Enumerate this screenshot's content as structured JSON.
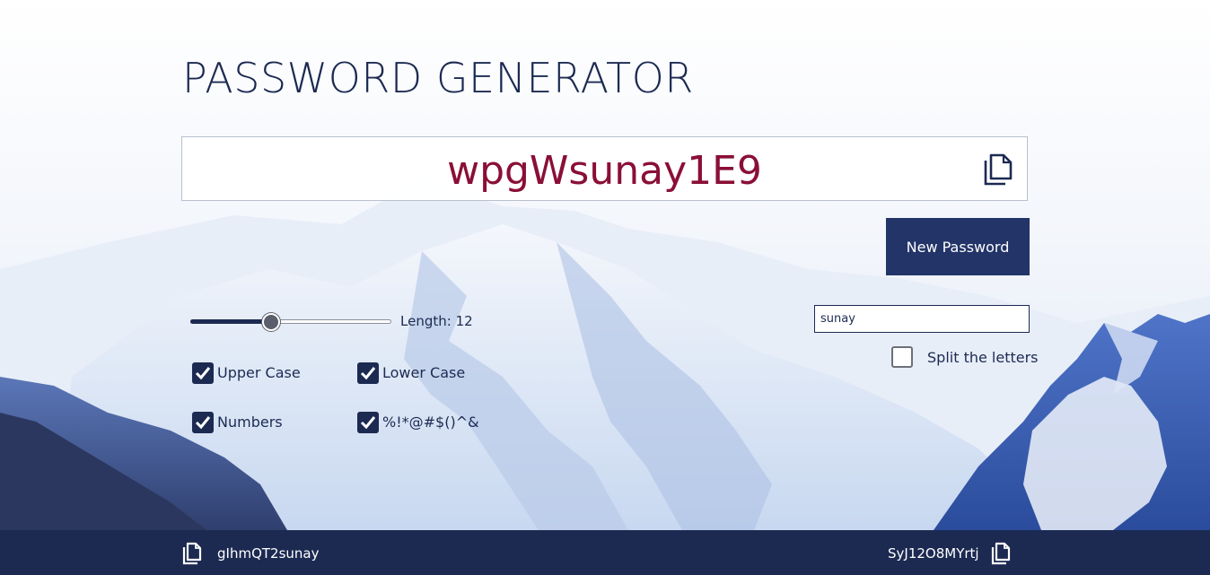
{
  "app": {
    "title": "PASSWORD GENERATOR"
  },
  "output": {
    "password": "wpgWsunay1E9",
    "copy_icon": "copy-icon"
  },
  "actions": {
    "new_password_label": "New Password"
  },
  "length": {
    "label": "Length:",
    "value": 12,
    "min": 4,
    "max": 24
  },
  "options": [
    {
      "label": "Upper Case",
      "checked": true
    },
    {
      "label": "Lower Case",
      "checked": true
    },
    {
      "label": "Numbers",
      "checked": true
    },
    {
      "label": "%!*@#$()^&",
      "checked": true
    }
  ],
  "word": {
    "value": "sunay",
    "split_label": "Split the letters",
    "split_checked": false
  },
  "history": [
    {
      "password": "gIhmQT2sunay",
      "icon": "copy-icon"
    },
    {
      "password": "SyJ12O8MYrtj",
      "icon": "copy-icon"
    }
  ],
  "colors": {
    "primary": "#1c2a52",
    "button": "#233469",
    "password": "#8a0f36",
    "footer": "#1c2a52"
  }
}
